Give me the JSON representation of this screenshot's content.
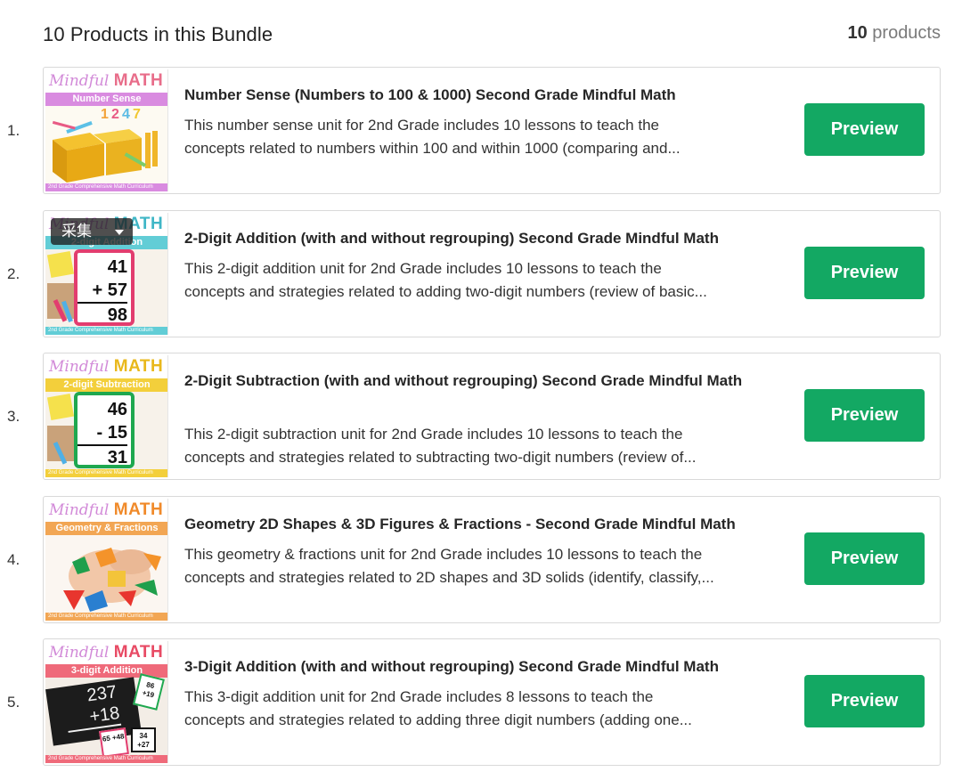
{
  "header": {
    "title": "10 Products in this Bundle",
    "count": "10",
    "count_suffix": "products"
  },
  "preview_label": "Preview",
  "collect_label": "采集",
  "thumb_brand": {
    "script": "Mindful",
    "caps": "MATH"
  },
  "thumb_footer": "2nd Grade Comprehensive Math Curriculum",
  "products": [
    {
      "num": "1.",
      "title": "Number Sense (Numbers to 100 & 1000) Second Grade Mindful Math",
      "desc1": "This number sense unit for 2nd Grade includes 10 lessons to teach the",
      "desc2": "concepts related to numbers within 100 and within 1000 (comparing and...",
      "band": "Number Sense",
      "band_color": "#d98be0",
      "art": "digits 1 2 4 7",
      "icon": "base-ten-blocks-icon"
    },
    {
      "num": "2.",
      "title": "2-Digit Addition (with and without regrouping) Second Grade Mindful Math",
      "desc1": "This 2-digit addition unit for 2nd Grade includes 10 lessons to teach the",
      "desc2": "concepts and strategies related to adding two-digit numbers (review of basic...",
      "band": "2-digit Addition",
      "band_color": "#62cdd6",
      "art_lines": [
        "41",
        "+ 57",
        "98"
      ],
      "icon": "whiteboard-icon"
    },
    {
      "num": "3.",
      "title": "2-Digit Subtraction (with and without regrouping) Second Grade Mindful Math",
      "desc1": "This 2-digit subtraction unit for 2nd Grade includes 10 lessons to teach the",
      "desc2": "concepts and strategies related to subtracting two-digit numbers (review of...",
      "band": "2-digit Subtraction",
      "band_color": "#f3cf3b",
      "art_lines": [
        "46",
        "- 15",
        "31"
      ],
      "icon": "whiteboard-icon"
    },
    {
      "num": "4.",
      "title": "Geometry 2D Shapes & 3D Figures & Fractions - Second Grade Mindful Math",
      "desc1": "This geometry & fractions unit for 2nd Grade includes 10 lessons to teach the",
      "desc2": "concepts and strategies related to 2D shapes and 3D solids (identify, classify,...",
      "band": "Geometry & Fractions",
      "band_color": "#f2a654",
      "icon": "pattern-blocks-icon"
    },
    {
      "num": "5.",
      "title": "3-Digit Addition (with and without regrouping) Second Grade Mindful Math",
      "desc1": "This 3-digit addition unit for 2nd Grade includes 8 lessons to teach the",
      "desc2": "concepts and strategies related to adding three digit numbers (adding one...",
      "band": "3-digit Addition",
      "band_color": "#ef6a7a",
      "art_lines": [
        "237",
        "+18"
      ],
      "cards": [
        "86 +19",
        "65 +48",
        "34 +27"
      ],
      "icon": "chalkboard-icon"
    }
  ]
}
